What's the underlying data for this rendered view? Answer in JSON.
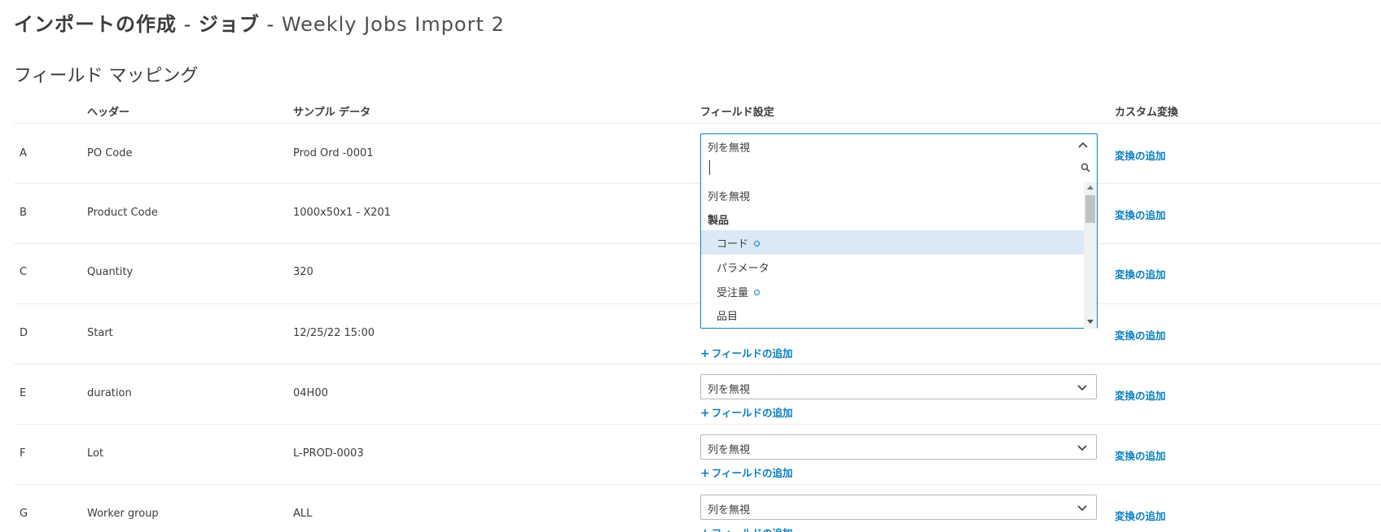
{
  "page": {
    "title_part1": "インポートの作成",
    "title_sep1": " - ",
    "title_part2": "ジョブ",
    "title_sep2": " - ",
    "title_name": "Weekly Jobs Import 2",
    "section_title": "フィールド マッピング"
  },
  "table": {
    "headers": [
      "ヘッダー",
      "サンプル データ",
      "フィールド設定",
      "カスタム変換"
    ],
    "rows": [
      {
        "letter": "A",
        "header": "PO Code",
        "sample": "Prod Ord -0001",
        "field": "列を無視",
        "custom": "変換の追加"
      },
      {
        "letter": "B",
        "header": "Product Code",
        "sample": "1000x50x1 - X201",
        "field": "",
        "custom": "変換の追加"
      },
      {
        "letter": "C",
        "header": "Quantity",
        "sample": "320",
        "field": "",
        "custom": "変換の追加"
      },
      {
        "letter": "D",
        "header": "Start",
        "sample": "12/25/22 15:00",
        "field": "",
        "custom": "変換の追加"
      },
      {
        "letter": "E",
        "header": "duration",
        "sample": "04H00",
        "field": "列を無視",
        "custom": "変換の追加"
      },
      {
        "letter": "F",
        "header": "Lot",
        "sample": "L-PROD-0003",
        "field": "列を無視",
        "custom": "変換の追加"
      },
      {
        "letter": "G",
        "header": "Worker group",
        "sample": "ALL",
        "field": "列を無視",
        "custom": "変換の追加"
      }
    ],
    "add_field_label": "フィールドの追加"
  },
  "dropdown": {
    "current_value": "列を無視",
    "search_value": "",
    "items": [
      {
        "label": "列を無視",
        "kind": "option",
        "required": false
      },
      {
        "label": "製品",
        "kind": "group",
        "required": false
      },
      {
        "label": "コード",
        "kind": "option",
        "required": true,
        "selected": true
      },
      {
        "label": "パラメータ",
        "kind": "option",
        "required": false
      },
      {
        "label": "受注量",
        "kind": "option",
        "required": true
      },
      {
        "label": "品目",
        "kind": "option",
        "required": false
      }
    ]
  },
  "colors": {
    "accent": "#0a7fc0",
    "selected_bg": "#dde8f7",
    "text": "#3c3c3c"
  }
}
